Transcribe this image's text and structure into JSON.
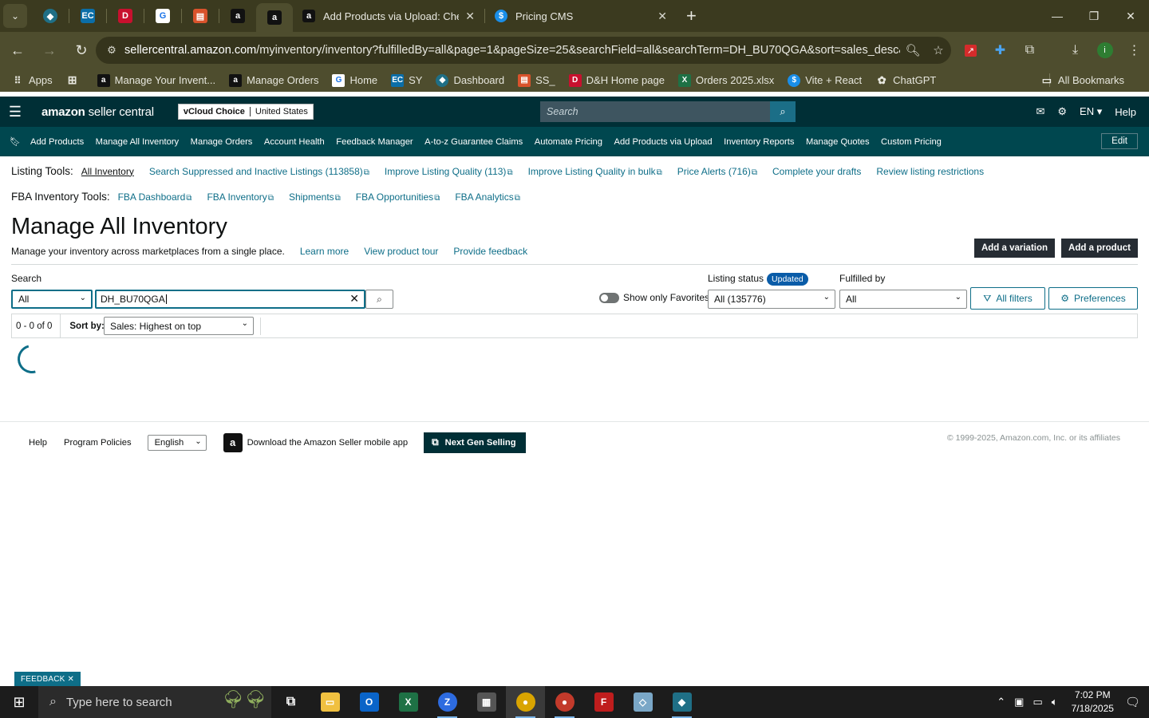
{
  "browser": {
    "tabs": [
      {
        "title": "Add Products via Upload: Check",
        "active": false
      },
      {
        "title": "Pricing CMS",
        "active": false
      }
    ],
    "url_host": "sellercentral.amazon.com",
    "url_path": "/myinventory/inventory?fulfilledBy=all&page=1&pageSize=25&searchField=all&searchTerm=DH_BU70QGA&sort=sales_desc&s...",
    "bookmarks": [
      {
        "label": "Apps"
      },
      {
        "label": "Manage Your Invent..."
      },
      {
        "label": "Manage Orders"
      },
      {
        "label": "Home"
      },
      {
        "label": "SY"
      },
      {
        "label": "Dashboard"
      },
      {
        "label": "SS_"
      },
      {
        "label": "D&H Home page"
      },
      {
        "label": "Orders 2025.xlsx"
      },
      {
        "label": "Vite + React"
      },
      {
        "label": "ChatGPT"
      }
    ],
    "all_bookmarks": "All Bookmarks"
  },
  "amazon": {
    "logo_bold": "amazon",
    "logo_rest": " seller central",
    "account": "vCloud Choice",
    "country": "United States",
    "search_placeholder": "Search",
    "lang": "EN ▾",
    "help": "Help",
    "nav": [
      "Add Products",
      "Manage All Inventory",
      "Manage Orders",
      "Account Health",
      "Feedback Manager",
      "A-to-z Guarantee Claims",
      "Automate Pricing",
      "Add Products via Upload",
      "Inventory Reports",
      "Manage Quotes",
      "Custom Pricing"
    ],
    "edit": "Edit"
  },
  "listing_tools": {
    "label": "Listing Tools:",
    "links": [
      "All Inventory",
      "Search Suppressed and Inactive Listings (113858)",
      "Improve Listing Quality (113)",
      "Improve Listing Quality in bulk",
      "Price Alerts (716)",
      "Complete your drafts",
      "Review listing restrictions"
    ]
  },
  "fba_tools": {
    "label": "FBA Inventory Tools:",
    "links": [
      "FBA Dashboard",
      "FBA Inventory",
      "Shipments",
      "FBA Opportunities",
      "FBA Analytics"
    ]
  },
  "page": {
    "title": "Manage All Inventory",
    "subtitle": "Manage your inventory across marketplaces from a single place.",
    "learn_more": "Learn more",
    "tour": "View product tour",
    "feedback": "Provide feedback",
    "add_variation": "Add a variation",
    "add_product": "Add a product"
  },
  "filters": {
    "search_label": "Search",
    "search_field": "All",
    "search_value": "DH_BU70QGA",
    "favorites_label": "Show only Favorites",
    "listing_status_label": "Listing status",
    "listing_status_badge": "Updated",
    "listing_status_value": "All (135776)",
    "fulfilled_label": "Fulfilled by",
    "fulfilled_value": "All",
    "all_filters": "All filters",
    "preferences": "Preferences"
  },
  "results": {
    "count": "0 - 0 of 0",
    "sort_label": "Sort by:",
    "sort_value": "Sales: Highest on top"
  },
  "footer": {
    "help": "Help",
    "policies": "Program Policies",
    "language": "English",
    "download": "Download the Amazon Seller mobile app",
    "next_gen": "Next Gen Selling",
    "copyright": "© 1999-2025, Amazon.com, Inc. or its affiliates"
  },
  "feedback_tab": "FEEDBACK ✕",
  "taskbar": {
    "search_placeholder": "Type here to search",
    "time": "7:02 PM",
    "date": "7/18/2025"
  }
}
